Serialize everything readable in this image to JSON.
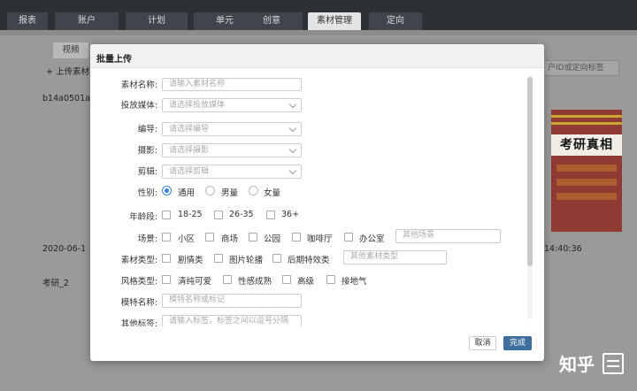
{
  "topnav": {
    "tabs": [
      {
        "label": "报表"
      },
      {
        "label": "账户"
      },
      {
        "label": "计划"
      },
      {
        "label": "单元"
      },
      {
        "label": "创意"
      },
      {
        "label": "素材管理"
      },
      {
        "label": "定向"
      }
    ],
    "active_tab": "素材管理"
  },
  "background": {
    "tab_video": "视频",
    "upload_label": "+ 上传素材",
    "row1_name": "b14a0501a",
    "row1_date": "2020-06-1",
    "row1_time": "14:40:36",
    "row2_name": "考研_2",
    "search_placeholder": "户ID或定向标签",
    "poster_title": "考研真相"
  },
  "modal": {
    "title": "批量上传",
    "fields": {
      "material_name": {
        "label": "素材名称:",
        "placeholder": "请输入素材名称"
      },
      "media": {
        "label": "投放媒体:",
        "placeholder": "请选择投放媒体"
      },
      "director": {
        "label": "编导:",
        "placeholder": "请选择编导"
      },
      "camera": {
        "label": "摄影:",
        "placeholder": "请选择摄影"
      },
      "editor": {
        "label": "剪辑:",
        "placeholder": "请选择剪辑"
      },
      "gender": {
        "label": "性别:",
        "options": [
          "通用",
          "男量",
          "女量"
        ],
        "selected": "通用"
      },
      "age": {
        "label": "年龄段:",
        "options": [
          "18-25",
          "26-35",
          "36+"
        ]
      },
      "scene": {
        "label": "场景:",
        "options": [
          "小区",
          "商场",
          "公园",
          "咖啡厅",
          "办公室"
        ],
        "other_placeholder": "其他场景"
      },
      "material_type": {
        "label": "素材类型:",
        "options": [
          "剧情类",
          "图片轮播",
          "后期特效类"
        ],
        "other_placeholder": "其他素材类型"
      },
      "style_type": {
        "label": "风格类型:",
        "options": [
          "清纯可爱",
          "性感成熟",
          "高级",
          "接地气"
        ]
      },
      "model_name": {
        "label": "模特名称:",
        "placeholder": "模特名称或标记"
      },
      "other_tags": {
        "label": "其他标签:",
        "placeholder": "请输入标签，标签之间以逗号分隔"
      }
    },
    "footer": {
      "cancel": "取消",
      "confirm": "完成"
    }
  },
  "watermark": {
    "text": "知乎"
  },
  "colors": {
    "accent": "#3a7fd5",
    "primary_button": "#3f6f9e",
    "nav_bg": "#2c3136"
  },
  "icons": {
    "select_arrow": "chevron-down-icon"
  }
}
